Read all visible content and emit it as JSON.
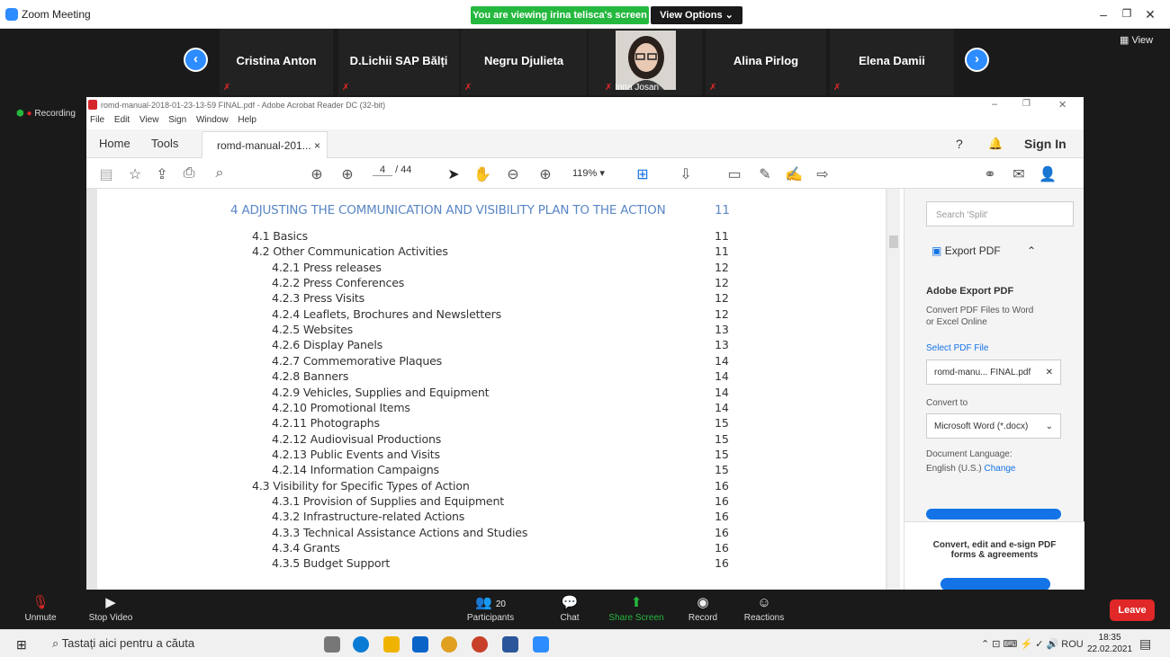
{
  "zoom": {
    "title": "Zoom Meeting",
    "viewing_banner": "You are viewing irina telisca's screen",
    "view_options": "View Options ⌄",
    "view_label": "View",
    "recording": "Recording",
    "participants_tiles": [
      "Cristina Anton",
      "D.Lichii SAP Bălți",
      "Negru Djulieta",
      "Inna Josan",
      "Alina Pirlog",
      "Elena Damii"
    ],
    "bottom_bar": {
      "unmute": "Unmute",
      "stop_video": "Stop Video",
      "participants": "Participants",
      "participants_count": "20",
      "chat": "Chat",
      "share_screen": "Share Screen",
      "record": "Record",
      "reactions": "Reactions",
      "leave": "Leave"
    }
  },
  "acrobat": {
    "title": "romd-manual-2018-01-23-13-59 FINAL.pdf - Adobe Acrobat Reader DC (32-bit)",
    "menu": [
      "File",
      "Edit",
      "View",
      "Sign",
      "Window",
      "Help"
    ],
    "tabs": {
      "home": "Home",
      "tools": "Tools",
      "doc": "romd-manual-201... ×",
      "sign_in": "Sign In"
    },
    "page_current": "4",
    "page_total": "/ 44",
    "zoom": "119%  ▾",
    "toc": [
      {
        "label": "4 ADJUSTING THE COMMUNICATION AND VISIBILITY PLAN TO THE ACTION",
        "page": "11",
        "level": 0
      },
      {
        "label": "4.1 Basics",
        "page": "11",
        "level": 1
      },
      {
        "label": "4.2 Other Communication Activities",
        "page": "11",
        "level": 1
      },
      {
        "label": "4.2.1 Press releases",
        "page": "12",
        "level": 2
      },
      {
        "label": "4.2.2 Press Conferences",
        "page": "12",
        "level": 2
      },
      {
        "label": "4.2.3 Press Visits",
        "page": "12",
        "level": 2
      },
      {
        "label": "4.2.4 Leaflets, Brochures and Newsletters",
        "page": "12",
        "level": 2
      },
      {
        "label": "4.2.5 Websites",
        "page": "13",
        "level": 2
      },
      {
        "label": "4.2.6 Display Panels",
        "page": "13",
        "level": 2
      },
      {
        "label": "4.2.7 Commemorative Plaques",
        "page": "14",
        "level": 2
      },
      {
        "label": "4.2.8 Banners",
        "page": "14",
        "level": 2
      },
      {
        "label": "4.2.9 Vehicles, Supplies and Equipment",
        "page": "14",
        "level": 2
      },
      {
        "label": "4.2.10 Promotional Items",
        "page": "14",
        "level": 2
      },
      {
        "label": "4.2.11 Photographs",
        "page": "15",
        "level": 2
      },
      {
        "label": "4.2.12 Audiovisual Productions",
        "page": "15",
        "level": 2
      },
      {
        "label": "4.2.13 Public Events and Visits",
        "page": "15",
        "level": 2
      },
      {
        "label": "4.2.14 Information Campaigns",
        "page": "15",
        "level": 2
      },
      {
        "label": "4.3 Visibility for Specific Types of Action",
        "page": "16",
        "level": 1
      },
      {
        "label": "4.3.1 Provision of Supplies and Equipment",
        "page": "16",
        "level": 2
      },
      {
        "label": "4.3.2 Infrastructure-related Actions",
        "page": "16",
        "level": 2
      },
      {
        "label": "4.3.3 Technical Assistance Actions and Studies",
        "page": "16",
        "level": 2
      },
      {
        "label": "4.3.4 Grants",
        "page": "16",
        "level": 2
      },
      {
        "label": "4.3.5 Budget Support",
        "page": "16",
        "level": 2
      }
    ],
    "right_pane": {
      "search_placeholder": "Search 'Split'",
      "export_pdf": "Export PDF",
      "adobe_export": "Adobe Export PDF",
      "convert_desc": "Convert PDF Files to Word or Excel Online",
      "select_file": "Select PDF File",
      "file_name": "romd-manu... FINAL.pdf",
      "convert_to": "Convert to",
      "format": "Microsoft Word (*.docx)",
      "doc_language": "Document Language:",
      "language": "English (U.S.)",
      "change": "Change",
      "promo": "Convert, edit and e-sign PDF forms & agreements"
    }
  },
  "taskbar": {
    "search": "Tastați aici pentru a căuta",
    "lang": "ROU",
    "time": "18:35",
    "date": "22.02.2021"
  }
}
